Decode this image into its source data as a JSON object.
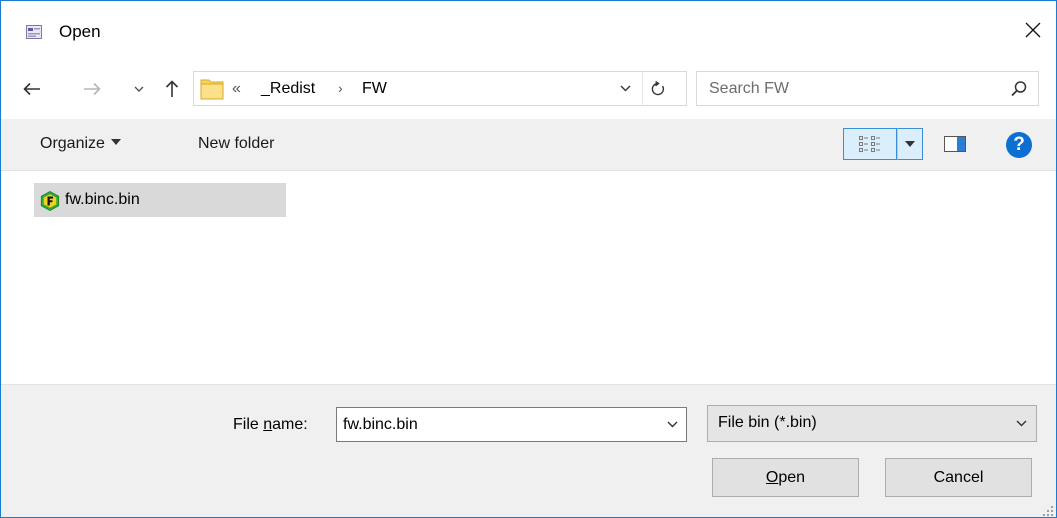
{
  "window": {
    "title": "Open"
  },
  "address": {
    "overflow": "«",
    "separator": "›",
    "crumbs": [
      "_Redist",
      "FW"
    ]
  },
  "search": {
    "placeholder": "Search FW",
    "value": ""
  },
  "toolbar": {
    "organize_label": "Organize",
    "new_folder_label": "New folder",
    "help_label": "?"
  },
  "files": [
    {
      "name": "fw.binc.bin",
      "icon": "hex-f-file-icon",
      "selected": true
    }
  ],
  "bottom": {
    "filename_label_prefix": "File ",
    "filename_label_access": "n",
    "filename_label_suffix": "ame:",
    "filename_value": "fw.binc.bin",
    "filter_value": "File bin (*.bin)",
    "open_access": "O",
    "open_rest": "pen",
    "cancel_label": "Cancel"
  },
  "colors": {
    "window_border": "#1a7ad4",
    "accent_blue": "#0d6fd1",
    "selection": "#d9d9d9",
    "panel_bg": "#f0f0f0",
    "file_icon_green": "#2eaa3c",
    "file_icon_yellow": "#f2d21b"
  }
}
